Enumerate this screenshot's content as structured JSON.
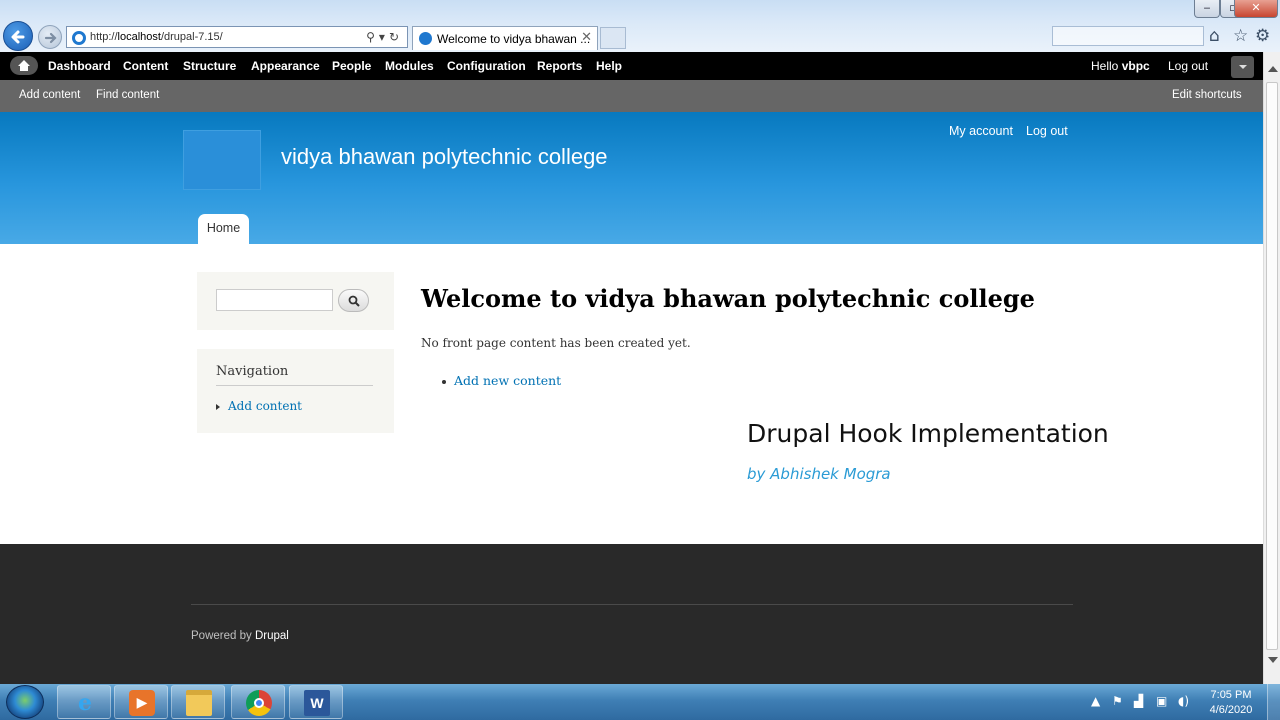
{
  "browser": {
    "url_prefix": "http://",
    "url_host": "localhost",
    "url_path": "/drupal-7.15/",
    "tab_title": "Welcome to vidya bhawan ...",
    "tab_close": "✕",
    "window_controls": {
      "minimize": "‒",
      "maximize": "▫",
      "close": "✕"
    },
    "icons": [
      "home-icon",
      "star-icon",
      "gear-icon"
    ]
  },
  "toolbar": {
    "items": [
      "Dashboard",
      "Content",
      "Structure",
      "Appearance",
      "People",
      "Modules",
      "Configuration",
      "Reports",
      "Help"
    ],
    "hello_prefix": "Hello ",
    "username": "vbpc",
    "logout": "Log out"
  },
  "shortcuts": {
    "add_content": "Add content",
    "find_content": "Find content",
    "edit_shortcuts": "Edit shortcuts"
  },
  "header": {
    "site_name": "vidya bhawan polytechnic college",
    "my_account": "My account",
    "logout": "Log out",
    "home_tab": "Home"
  },
  "sidebar": {
    "navigation_title": "Navigation",
    "navigation_link": "Add content"
  },
  "main": {
    "title": "Welcome to vidya bhawan polytechnic college",
    "message": "No front page content has been created yet.",
    "add_link": "Add new content"
  },
  "overlay": {
    "title": "Drupal Hook Implementation",
    "subtitle": "by Abhishek Mogra"
  },
  "footer": {
    "powered_prefix": "Powered by ",
    "powered_link": "Drupal"
  },
  "taskbar": {
    "time": "7:05 PM",
    "date": "4/6/2020"
  },
  "colors": {
    "header_blue": "#0779bf",
    "link_blue": "#0071b3",
    "toolbar_black": "#000000",
    "footer_dark": "#292929",
    "overlay_sub": "#2a9bd5"
  }
}
